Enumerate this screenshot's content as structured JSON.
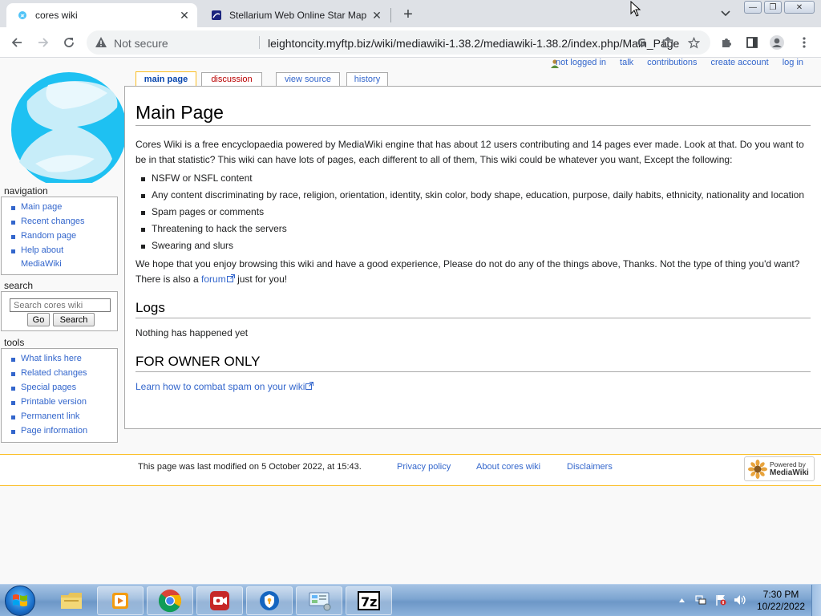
{
  "browser": {
    "tabs": [
      {
        "title": "cores wiki",
        "active": true
      },
      {
        "title": "Stellarium Web Online Star Map",
        "active": false
      }
    ],
    "security_label": "Not secure",
    "url": "leightoncity.myftp.biz/wiki/mediawiki-1.38.2/mediawiki-1.38.2/index.php/Main_Page"
  },
  "personal_tools": {
    "not_logged_in": "not logged in",
    "talk": "talk",
    "contributions": "contributions",
    "create_account": "create account",
    "log_in": "log in"
  },
  "content_tabs": {
    "main_page": "main page",
    "discussion": "discussion",
    "view_source": "view source",
    "history": "history"
  },
  "article": {
    "title": "Main Page",
    "intro": "Cores Wiki is a free encyclopaedia powered by MediaWiki engine that has about 12 users contributing and 14 pages ever made. Look at that. Do you want to be in that statistic? This wiki can have lots of pages, each different to all of them, This wiki could be whatever you want, Except the following:",
    "rules": [
      "NSFW or NSFL content",
      "Any content discriminating by race, religion, orientation, identity, skin color, body shape, education, purpose, daily habits, ethnicity, nationality and location",
      "Spam pages or comments",
      "Threatening to hack the servers",
      "Swearing and slurs"
    ],
    "outro_before": "We hope that you enjoy browsing this wiki and have a good experience, Please do not do any of the things above, Thanks. Not the type of thing you'd want? There is also a ",
    "forum_link": "forum",
    "outro_after": " just for you!",
    "logs_heading": "Logs",
    "logs_text": "Nothing has happened yet",
    "owner_heading": "FOR OWNER ONLY",
    "spam_link": "Learn how to combat spam on your wiki"
  },
  "sidebar": {
    "navigation_heading": "navigation",
    "navigation": [
      "Main page",
      "Recent changes",
      "Random page",
      "Help about MediaWiki"
    ],
    "search_heading": "search",
    "search_placeholder": "Search cores wiki",
    "go_label": "Go",
    "search_label": "Search",
    "tools_heading": "tools",
    "tools": [
      "What links here",
      "Related changes",
      "Special pages",
      "Printable version",
      "Permanent link",
      "Page information"
    ]
  },
  "footer": {
    "last_modified": "This page was last modified on 5 October 2022, at 15:43.",
    "privacy": "Privacy policy",
    "about": "About cores wiki",
    "disclaimers": "Disclaimers",
    "powered_by_line1": "Powered by",
    "powered_by_line2": "MediaWiki"
  },
  "taskbar": {
    "apps": [
      "file-explorer",
      "media-player",
      "chrome",
      "screen-recorder",
      "vpn-shield",
      "control-panel",
      "7zip"
    ],
    "time": "7:30 PM",
    "date": "10/22/2022"
  },
  "colors": {
    "link": "#3366cc",
    "tab_active_border": "#fabd23",
    "discussion_red": "#ba0000"
  }
}
